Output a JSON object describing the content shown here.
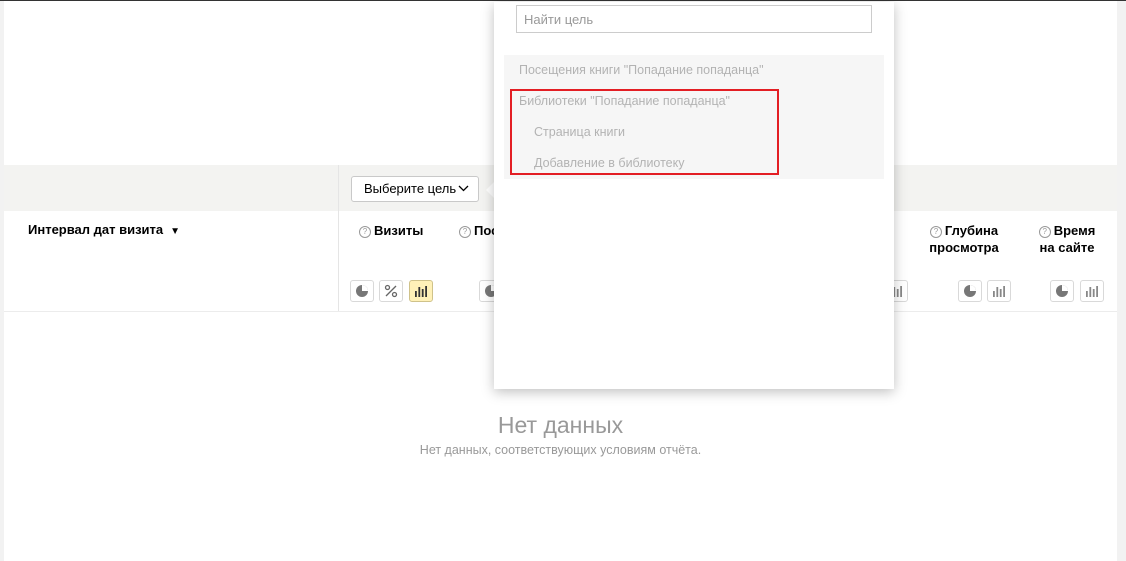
{
  "toolbar": {
    "goal_select_label": "Выберите цель"
  },
  "table": {
    "dimension_header": "Интервал дат визита",
    "sort_indicator": "▼",
    "metrics": [
      {
        "label": "Визиты"
      },
      {
        "label": "Пос"
      },
      {
        "label_line1": "Глубина",
        "label_line2": "просмотра"
      },
      {
        "label_line1": "Время",
        "label_line2": "на сайте"
      }
    ],
    "help_glyph": "?"
  },
  "goal_dropdown": {
    "search_placeholder": "Найти цель",
    "search_value": "",
    "items": [
      {
        "label": "Посещения книги \"Попадание попаданца\"",
        "level": 0
      },
      {
        "label": "Библиотеки \"Попадание попаданца\"",
        "level": 0
      },
      {
        "label": "Страница книги",
        "level": 1
      },
      {
        "label": "Добавление в библиотеку",
        "level": 1
      }
    ]
  },
  "empty_state": {
    "title": "Нет данных",
    "text": "Нет данных, соответствующих условиям отчёта."
  },
  "colors": {
    "active_view_button": "#fff1b8",
    "highlight_border": "#e31e24",
    "muted_text": "#999999"
  },
  "icons": {
    "view_pie": "pie-chart-icon",
    "view_percent": "percent-icon",
    "view_bars": "bar-chart-icon",
    "help": "help-circle-icon",
    "dropdown": "chevron-down-icon"
  }
}
